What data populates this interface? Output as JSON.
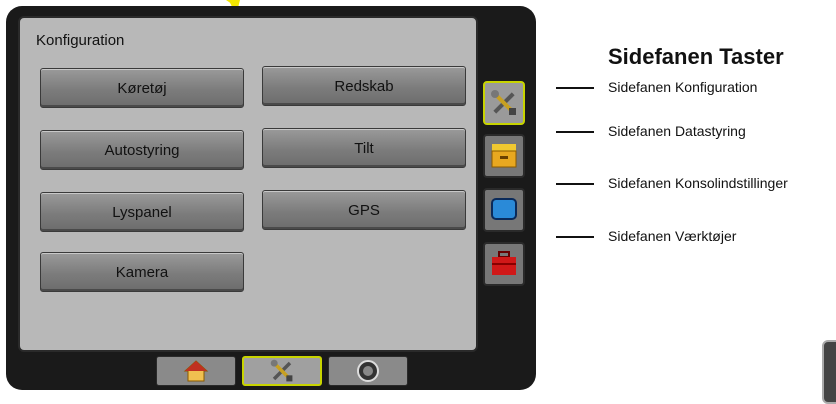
{
  "config_screen": {
    "title": "Konfiguration",
    "buttons": [
      {
        "label": "Køretøj"
      },
      {
        "label": "Redskab"
      },
      {
        "label": "Autostyring"
      },
      {
        "label": "Tilt"
      },
      {
        "label": "Lyspanel"
      },
      {
        "label": "GPS"
      },
      {
        "label": "Kamera"
      }
    ]
  },
  "side_tabs": [
    {
      "icon": "tools-icon",
      "active": true
    },
    {
      "icon": "drawer-icon",
      "active": false
    },
    {
      "icon": "monitor-icon",
      "active": false
    },
    {
      "icon": "toolbox-icon",
      "active": false
    }
  ],
  "bottom_tabs": [
    {
      "icon": "home-icon",
      "active": false
    },
    {
      "icon": "tools-icon",
      "active": true
    },
    {
      "icon": "gauge-icon",
      "active": false
    }
  ],
  "doc": {
    "heading": "Sidefanen Taster",
    "callouts": [
      "Sidefanen Konfiguration",
      "Sidefanen Datastyring",
      "Sidefanen Konsolindstillinger",
      "Sidefanen Værktøjer"
    ]
  },
  "colors": {
    "highlight": "#f2e600",
    "active_border": "#c8d400",
    "screen_bg": "#b8b8b8",
    "bezel": "#1a1a1a"
  }
}
